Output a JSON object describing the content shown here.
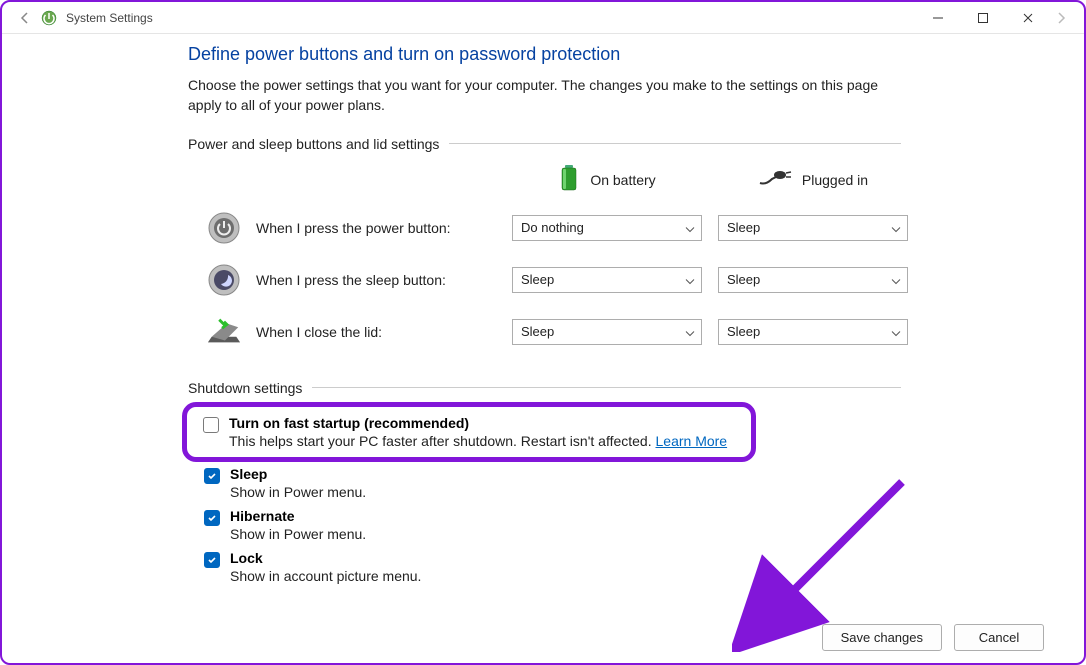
{
  "window": {
    "title": "System Settings"
  },
  "page": {
    "title": "Define power buttons and turn on password protection",
    "description": "Choose the power settings that you want for your computer. The changes you make to the settings on this page apply to all of your power plans."
  },
  "power_section": {
    "header": "Power and sleep buttons and lid settings",
    "col_battery": "On battery",
    "col_plugged": "Plugged in",
    "rows": [
      {
        "label": "When I press the power button:",
        "battery": "Do nothing",
        "plugged": "Sleep"
      },
      {
        "label": "When I press the sleep button:",
        "battery": "Sleep",
        "plugged": "Sleep"
      },
      {
        "label": "When I close the lid:",
        "battery": "Sleep",
        "plugged": "Sleep"
      }
    ]
  },
  "shutdown_section": {
    "header": "Shutdown settings",
    "items": [
      {
        "title": "Turn on fast startup (recommended)",
        "desc": "This helps start your PC faster after shutdown. Restart isn't affected. ",
        "checked": false,
        "learn_more": "Learn More"
      },
      {
        "title": "Sleep",
        "desc": "Show in Power menu.",
        "checked": true
      },
      {
        "title": "Hibernate",
        "desc": "Show in Power menu.",
        "checked": true
      },
      {
        "title": "Lock",
        "desc": "Show in account picture menu.",
        "checked": true
      }
    ]
  },
  "buttons": {
    "save": "Save changes",
    "cancel": "Cancel"
  }
}
